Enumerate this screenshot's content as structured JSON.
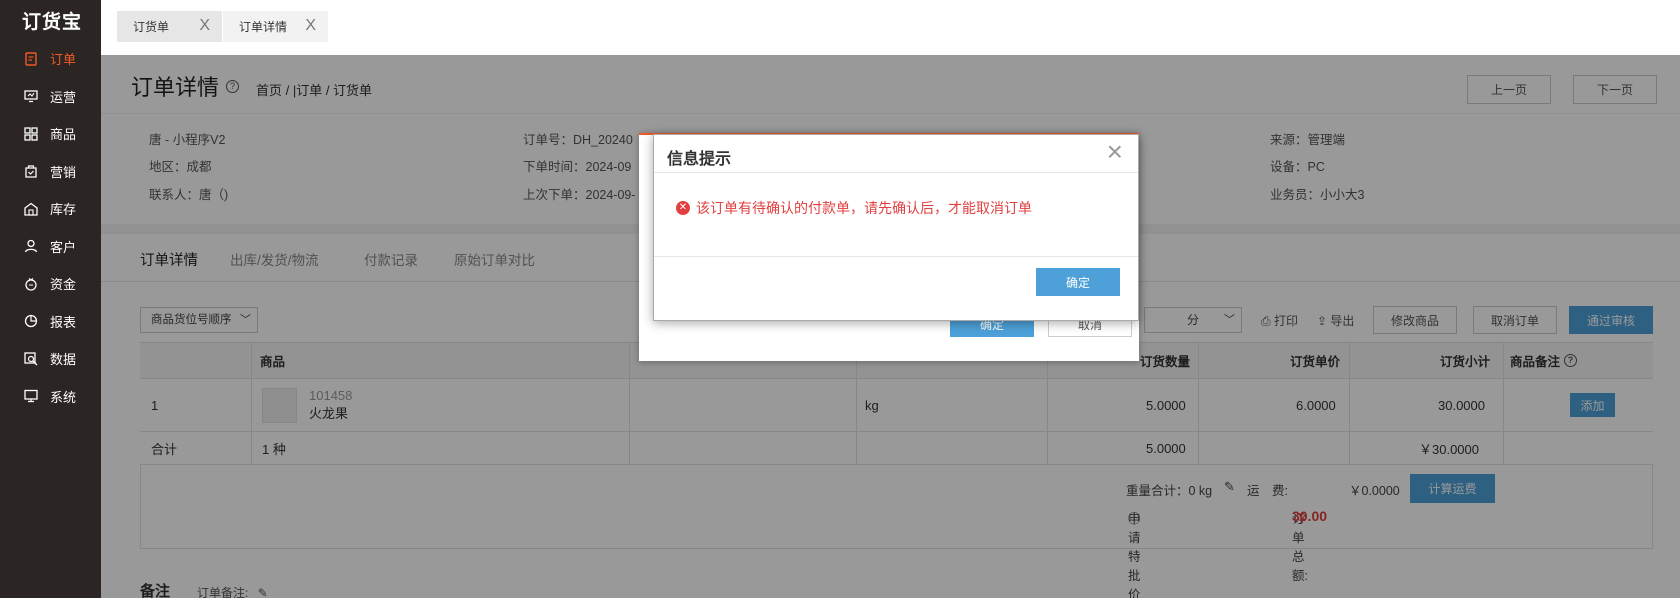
{
  "app": {
    "logo": "订货宝"
  },
  "sidebar": {
    "items": [
      {
        "label": "订单",
        "icon": "order-icon",
        "active": true
      },
      {
        "label": "运营",
        "icon": "operation-icon"
      },
      {
        "label": "商品",
        "icon": "product-icon"
      },
      {
        "label": "营销",
        "icon": "marketing-icon"
      },
      {
        "label": "库存",
        "icon": "inventory-icon"
      },
      {
        "label": "客户",
        "icon": "customer-icon"
      },
      {
        "label": "资金",
        "icon": "funds-icon"
      },
      {
        "label": "报表",
        "icon": "report-icon"
      },
      {
        "label": "数据",
        "icon": "data-icon"
      },
      {
        "label": "系统",
        "icon": "system-icon"
      }
    ]
  },
  "page_tabs": [
    {
      "label": "订货单",
      "close": "X"
    },
    {
      "label": "订单详情",
      "close": "X",
      "active": true
    }
  ],
  "header": {
    "title": "订单详情",
    "help": "?",
    "breadcrumb": "首页 / |订单 / 订货单",
    "prev_label": "上一页",
    "next_label": "下一页"
  },
  "info": {
    "customer": "唐 - 小程序V2",
    "region": "地区：成都",
    "contact": "联系人：唐（)",
    "order_no": "订单号：DH_20240",
    "order_time": "下单时间：2024-09",
    "last_order": "上次下单：2024-09-",
    "source": "来源：管理端",
    "device": "设备：PC",
    "salesman": "业务员：小小大3"
  },
  "subtabs": [
    "订单详情",
    "出库/发货/物流",
    "付款记录",
    "原始订单对比"
  ],
  "toolbar": {
    "sort_select": "商品货位号顺序",
    "select2": "分",
    "print": "打印",
    "export": "导出",
    "modify": "修改商品",
    "cancel_order": "取消订单",
    "approve": "通过审核"
  },
  "table": {
    "headers": {
      "product": "商品",
      "qty": "订货数量",
      "price": "订货单价",
      "subtotal": "订货小计",
      "remark": "商品备注"
    },
    "row": {
      "index": "1",
      "code": "101458",
      "name": "火龙果",
      "unit": "kg",
      "qty": "5.0000",
      "price": "6.0000",
      "subtotal": "30.0000",
      "add": "添加"
    },
    "total_row": {
      "label": "合计",
      "kinds": "1 种",
      "qty": "5.0000",
      "subtotal": "￥30.0000"
    }
  },
  "summary": {
    "weight": "重量合计：0 kg",
    "freight_label": "运　费:",
    "freight": "￥0.0000",
    "calc_button": "计算运费",
    "special_price": "申请特批价",
    "total_label": "订单总额:",
    "total_currency": "￥",
    "total_value": "30.00"
  },
  "notes": {
    "title": "备注",
    "label": "订单备注:"
  },
  "under_dialog": {
    "confirm": "确定",
    "cancel": "取消"
  },
  "dialog": {
    "title": "信息提示",
    "close": "×",
    "message": "该订单有待确认的付款单，请先确认后，才能取消订单",
    "ok": "确定"
  },
  "colors": {
    "accent": "#f05a24",
    "primary": "#4da0d8",
    "error": "#e04040",
    "sidebar": "#2b2523"
  }
}
